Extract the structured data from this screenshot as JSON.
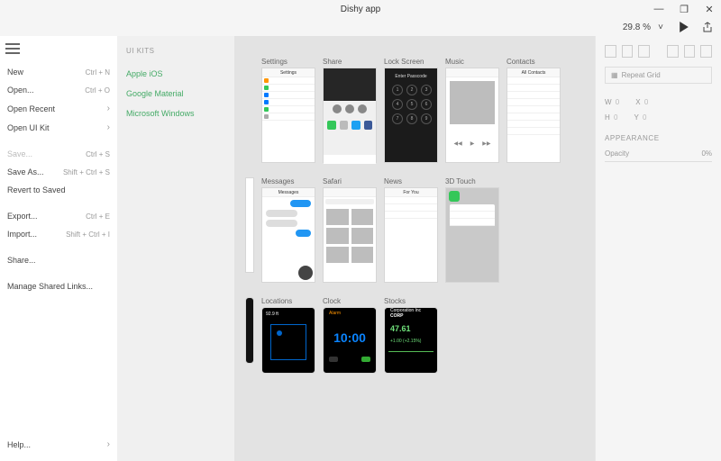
{
  "title": "Dishy app",
  "zoom": "29.8 %",
  "window_controls": {
    "minimize": "—",
    "restore": "❐",
    "close": "✕"
  },
  "menu": {
    "new": {
      "label": "New",
      "shortcut": "Ctrl + N"
    },
    "open": {
      "label": "Open...",
      "shortcut": "Ctrl + O"
    },
    "recent": {
      "label": "Open Recent"
    },
    "uikit": {
      "label": "Open UI Kit"
    },
    "save": {
      "label": "Save...",
      "shortcut": "Ctrl + S"
    },
    "saveas": {
      "label": "Save As...",
      "shortcut": "Shift + Ctrl + S"
    },
    "revert": {
      "label": "Revert to Saved"
    },
    "export": {
      "label": "Export...",
      "shortcut": "Ctrl + E"
    },
    "import": {
      "label": "Import...",
      "shortcut": "Shift + Ctrl + I"
    },
    "share": {
      "label": "Share..."
    },
    "managelinks": {
      "label": "Manage Shared Links..."
    },
    "help": {
      "label": "Help..."
    }
  },
  "ui_kits": {
    "header": "UI KITS",
    "items": {
      "ios": "Apple iOS",
      "material": "Google Material",
      "windows": "Microsoft Windows"
    }
  },
  "artboards": {
    "row1": {
      "settings": "Settings",
      "share": "Share",
      "lock": "Lock Screen",
      "music": "Music",
      "contacts": "Contacts"
    },
    "row2": {
      "messages": "Messages",
      "safari": "Safari",
      "news": "News",
      "threed": "3D Touch"
    },
    "row3": {
      "activity": "",
      "locations": "Locations",
      "clock": "Clock",
      "stocks": "Stocks"
    }
  },
  "lock": {
    "label": "Enter Passcode",
    "keys": [
      "1",
      "2",
      "3",
      "4",
      "5",
      "6",
      "7",
      "8",
      "9"
    ]
  },
  "clock": {
    "alarm": "Alarm",
    "time": "10:00"
  },
  "stocks": {
    "label1": "Corporation Inc",
    "sym": "CORP",
    "val": "47.61",
    "chg": "+1.00 (+2.15%)"
  },
  "rightpanel": {
    "repeat": "Repeat Grid",
    "w": "W",
    "x": "X",
    "h": "H",
    "y": "Y",
    "zero": "0",
    "appearance": "APPEARANCE",
    "opacity_label": "Opacity",
    "opacity_val": "0%"
  }
}
